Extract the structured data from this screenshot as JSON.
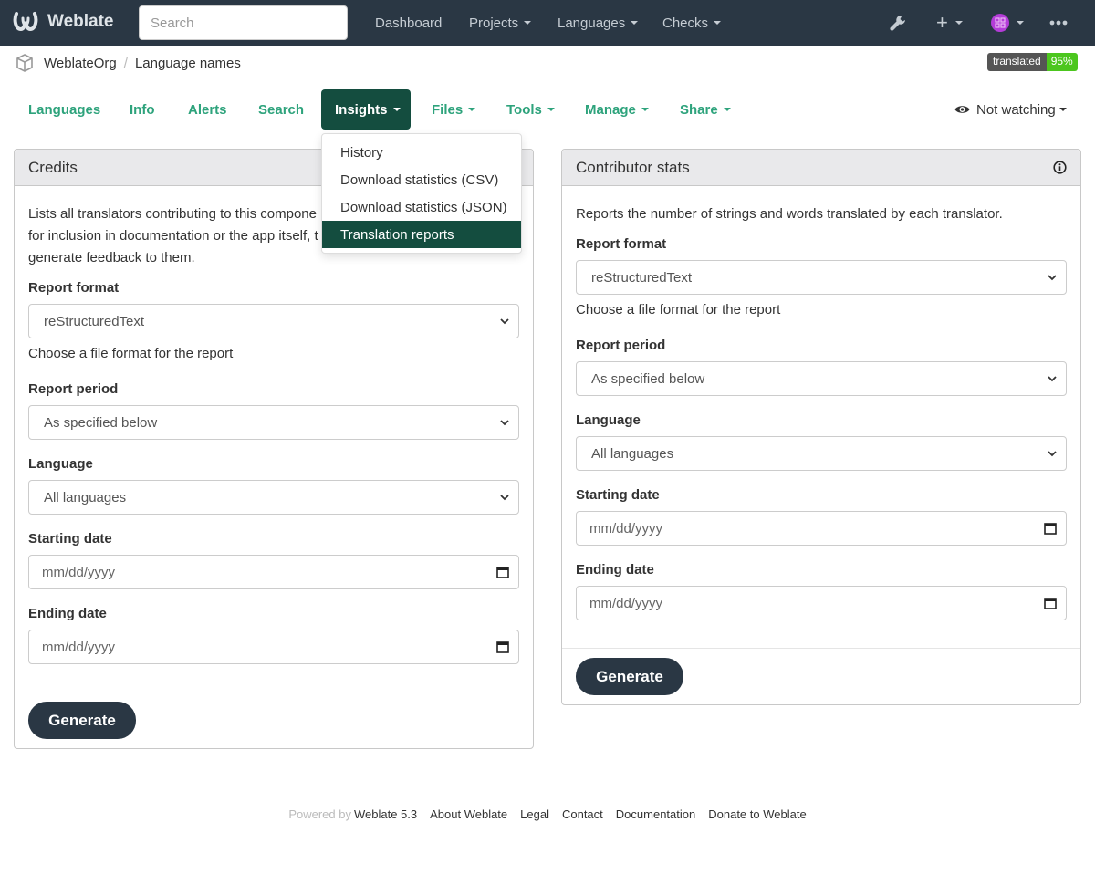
{
  "navbar": {
    "brand": "Weblate",
    "search_placeholder": "Search",
    "links": [
      {
        "label": "Dashboard",
        "dropdown": false
      },
      {
        "label": "Projects",
        "dropdown": true
      },
      {
        "label": "Languages",
        "dropdown": true
      },
      {
        "label": "Checks",
        "dropdown": true
      }
    ],
    "icons": [
      "wrench-icon",
      "plus-icon",
      "avatar",
      "more-icon"
    ]
  },
  "breadcrumb": {
    "project": "WeblateOrg",
    "component": "Language names"
  },
  "status_badge": {
    "label": "translated",
    "value": "95%",
    "color": "#4cc61e"
  },
  "tabs": [
    {
      "label": "Languages",
      "dropdown": false
    },
    {
      "label": "Info",
      "dropdown": false
    },
    {
      "label": "Alerts",
      "dropdown": false
    },
    {
      "label": "Search",
      "dropdown": false
    },
    {
      "label": "Insights",
      "dropdown": true,
      "active": true
    },
    {
      "label": "Files",
      "dropdown": true
    },
    {
      "label": "Tools",
      "dropdown": true
    },
    {
      "label": "Manage",
      "dropdown": true
    },
    {
      "label": "Share",
      "dropdown": true
    }
  ],
  "watch": {
    "label": "Not watching"
  },
  "insights_menu": {
    "items": [
      {
        "label": "History"
      },
      {
        "label": "Download statistics (CSV)"
      },
      {
        "label": "Download statistics (JSON)"
      },
      {
        "label": "Translation reports",
        "active": true
      }
    ]
  },
  "credits": {
    "title": "Credits",
    "description": [
      "Lists all translators contributing to this compone",
      "for inclusion in documentation or the app itself, t",
      "generate feedback to them."
    ],
    "report_format_label": "Report format",
    "report_format_value": "reStructuredText",
    "report_format_help": "Choose a file format for the report",
    "report_period_label": "Report period",
    "report_period_value": "As specified below",
    "language_label": "Language",
    "language_value": "All languages",
    "start_label": "Starting date",
    "start_placeholder": "mm/dd/yyyy",
    "end_label": "Ending date",
    "end_placeholder": "mm/dd/yyyy",
    "generate": "Generate"
  },
  "contributor": {
    "title": "Contributor stats",
    "description": "Reports the number of strings and words translated by each translator.",
    "report_format_label": "Report format",
    "report_format_value": "reStructuredText",
    "report_format_help": "Choose a file format for the report",
    "report_period_label": "Report period",
    "report_period_value": "As specified below",
    "language_label": "Language",
    "language_value": "All languages",
    "start_label": "Starting date",
    "start_placeholder": "mm/dd/yyyy",
    "end_label": "Ending date",
    "end_placeholder": "mm/dd/yyyy",
    "generate": "Generate"
  },
  "footer": {
    "powered_by": "Powered by",
    "links": [
      "Weblate 5.3",
      "About Weblate",
      "Legal",
      "Contact",
      "Documentation",
      "Donate to Weblate"
    ]
  },
  "colors": {
    "navbar": "#2a3744",
    "accent": "#2ea37c",
    "active_tab": "#144d3f"
  }
}
